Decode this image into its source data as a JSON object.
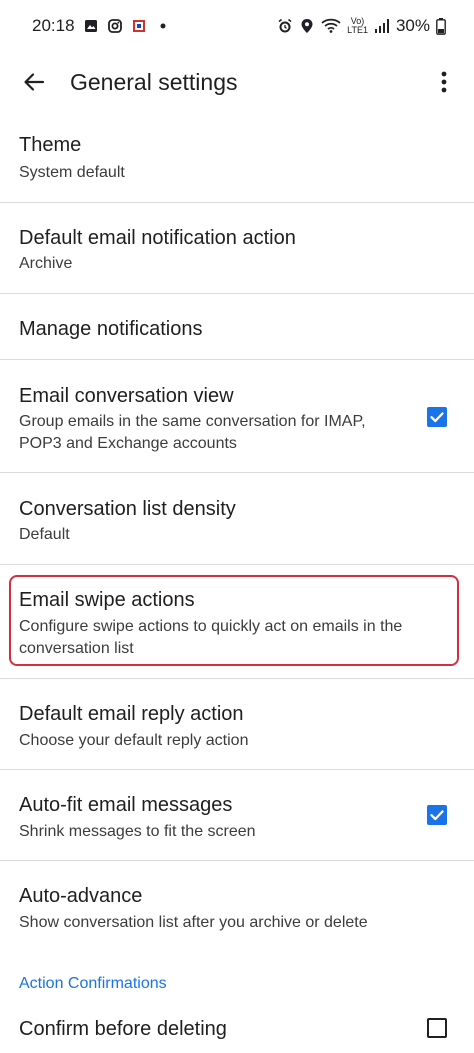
{
  "status_bar": {
    "time": "20:18",
    "network_label_top": "Vo)",
    "network_label_bottom": "LTE1",
    "battery": "30%",
    "left_icons": [
      "gallery-icon",
      "instagram-icon",
      "notification-app-icon",
      "dot-icon"
    ],
    "right_icons": [
      "alarm-icon",
      "location-icon",
      "wifi-icon",
      "signal-icon",
      "battery-icon"
    ]
  },
  "app_bar": {
    "title": "General settings",
    "back_icon": "arrow-back-icon",
    "more_icon": "more-vert-icon"
  },
  "settings": [
    {
      "title": "Theme",
      "summary": "System default",
      "checkbox": null
    },
    {
      "title": "Default email notification action",
      "summary": "Archive",
      "checkbox": null
    },
    {
      "title": "Manage notifications",
      "summary": "",
      "checkbox": null
    },
    {
      "title": "Email conversation view",
      "summary": "Group emails in the same conversation for IMAP, POP3 and Exchange accounts",
      "checkbox": true
    },
    {
      "title": "Conversation list density",
      "summary": "Default",
      "checkbox": null
    },
    {
      "title": "Email swipe actions",
      "summary": "Configure swipe actions to quickly act on emails in the conversation list",
      "checkbox": null,
      "highlighted": true
    },
    {
      "title": "Default email reply action",
      "summary": "Choose your default reply action",
      "checkbox": null
    },
    {
      "title": "Auto-fit email messages",
      "summary": "Shrink messages to fit the screen",
      "checkbox": true
    },
    {
      "title": "Auto-advance",
      "summary": "Show conversation list after you archive or delete",
      "checkbox": null
    }
  ],
  "section_header": "Action Confirmations",
  "partial_setting": {
    "title": "Confirm before deleting",
    "checkbox": false
  },
  "colors": {
    "accent": "#1a73e8",
    "highlight_border": "#d32f3f",
    "divider": "#dadce0"
  }
}
